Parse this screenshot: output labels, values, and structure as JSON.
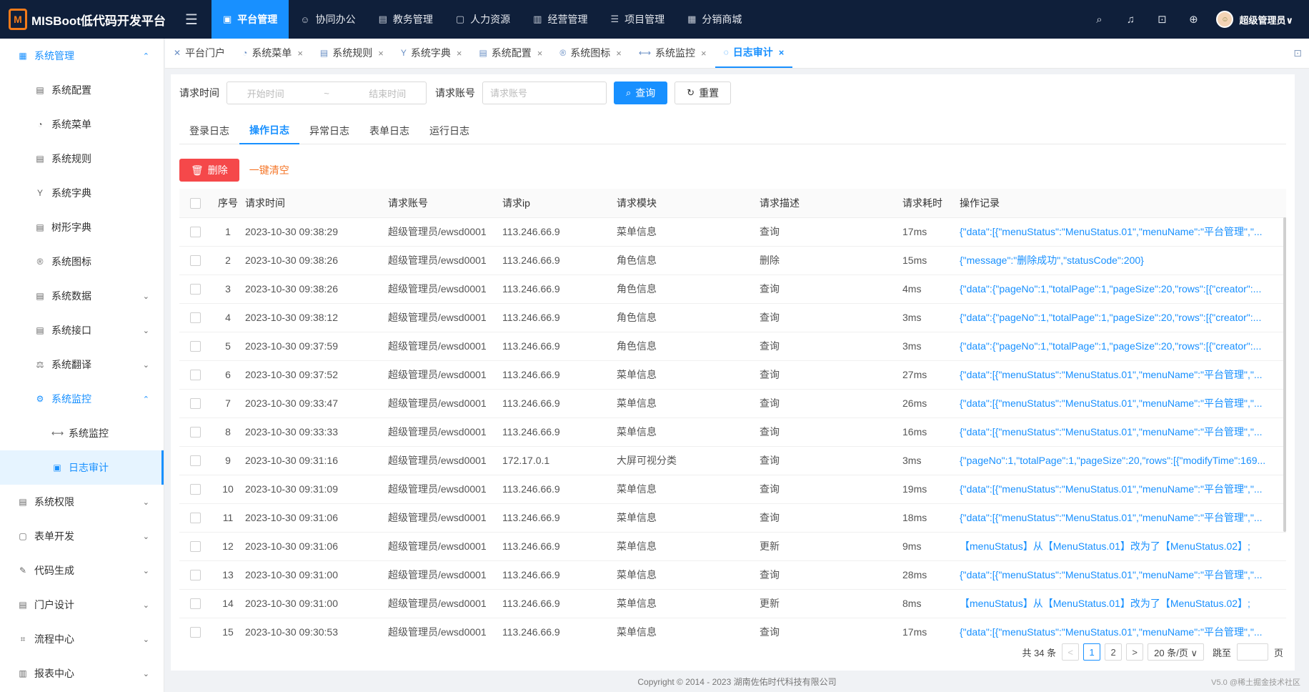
{
  "topbar": {
    "logo_mark": "M",
    "app_title": "MISBoot低代码开发平台",
    "nav": [
      {
        "label": "平台管理",
        "icon": "▣",
        "active": true
      },
      {
        "label": "协同办公",
        "icon": "☺",
        "active": false
      },
      {
        "label": "教务管理",
        "icon": "▤",
        "active": false
      },
      {
        "label": "人力资源",
        "icon": "▢",
        "active": false
      },
      {
        "label": "经营管理",
        "icon": "▥",
        "active": false
      },
      {
        "label": "项目管理",
        "icon": "☰",
        "active": false
      },
      {
        "label": "分销商城",
        "icon": "▦",
        "active": false
      }
    ],
    "user_name": "超级管理员∨"
  },
  "sidebar": {
    "items": [
      {
        "label": "系统管理",
        "icon": "▦",
        "level": 1,
        "arrow": "⌃",
        "state": "open"
      },
      {
        "label": "系统配置",
        "icon": "▤",
        "level": 2,
        "arrow": "",
        "state": ""
      },
      {
        "label": "系统菜单",
        "icon": "◔",
        "level": 2,
        "arrow": "",
        "state": ""
      },
      {
        "label": "系统规则",
        "icon": "▤",
        "level": 2,
        "arrow": "",
        "state": ""
      },
      {
        "label": "系统字典",
        "icon": "Y",
        "level": 2,
        "arrow": "",
        "state": ""
      },
      {
        "label": "树形字典",
        "icon": "▤",
        "level": 2,
        "arrow": "",
        "state": ""
      },
      {
        "label": "系统图标",
        "icon": "®",
        "level": 2,
        "arrow": "",
        "state": ""
      },
      {
        "label": "系统数据",
        "icon": "▤",
        "level": 2,
        "arrow": "⌄",
        "state": ""
      },
      {
        "label": "系统接口",
        "icon": "▤",
        "level": 2,
        "arrow": "⌄",
        "state": ""
      },
      {
        "label": "系统翻译",
        "icon": "⚖",
        "level": 2,
        "arrow": "⌄",
        "state": ""
      },
      {
        "label": "系统监控",
        "icon": "⚙",
        "level": 2,
        "arrow": "⌃",
        "state": "open"
      },
      {
        "label": "系统监控",
        "icon": "⟷",
        "level": 3,
        "arrow": "",
        "state": ""
      },
      {
        "label": "日志审计",
        "icon": "▣",
        "level": 3,
        "arrow": "",
        "state": "selected"
      },
      {
        "label": "系统权限",
        "icon": "▤",
        "level": 1,
        "arrow": "⌄",
        "state": ""
      },
      {
        "label": "表单开发",
        "icon": "▢",
        "level": 1,
        "arrow": "⌄",
        "state": ""
      },
      {
        "label": "代码生成",
        "icon": "✎",
        "level": 1,
        "arrow": "⌄",
        "state": ""
      },
      {
        "label": "门户设计",
        "icon": "▤",
        "level": 1,
        "arrow": "⌄",
        "state": ""
      },
      {
        "label": "流程中心",
        "icon": "⌗",
        "level": 1,
        "arrow": "⌄",
        "state": ""
      },
      {
        "label": "报表中心",
        "icon": "▥",
        "level": 1,
        "arrow": "⌄",
        "state": ""
      }
    ]
  },
  "tabs": [
    {
      "label": "平台门户",
      "icon": "✕",
      "closable": false,
      "active": false
    },
    {
      "label": "系统菜单",
      "icon": "◔",
      "closable": true,
      "active": false
    },
    {
      "label": "系统规则",
      "icon": "▤",
      "closable": true,
      "active": false
    },
    {
      "label": "系统字典",
      "icon": "Y",
      "closable": true,
      "active": false
    },
    {
      "label": "系统配置",
      "icon": "▤",
      "closable": true,
      "active": false
    },
    {
      "label": "系统图标",
      "icon": "®",
      "closable": true,
      "active": false
    },
    {
      "label": "系统监控",
      "icon": "⟷",
      "closable": true,
      "active": false
    },
    {
      "label": "日志审计",
      "icon": "◌",
      "closable": true,
      "active": true
    }
  ],
  "filter": {
    "time_label": "请求时间",
    "start_placeholder": "开始时间",
    "range_sep": "~",
    "end_placeholder": "结束时间",
    "account_label": "请求账号",
    "account_placeholder": "请求账号",
    "search_label": "查询",
    "reset_label": "重置"
  },
  "sub_tabs": [
    {
      "label": "登录日志",
      "active": false
    },
    {
      "label": "操作日志",
      "active": true
    },
    {
      "label": "异常日志",
      "active": false
    },
    {
      "label": "表单日志",
      "active": false
    },
    {
      "label": "运行日志",
      "active": false
    }
  ],
  "actions": {
    "delete_label": "删除",
    "clear_label": "一键清空"
  },
  "table": {
    "columns": [
      "",
      "序号",
      "请求时间",
      "请求账号",
      "请求ip",
      "请求模块",
      "请求描述",
      "请求耗时",
      "操作记录"
    ],
    "rows": [
      [
        "1",
        "2023-10-30 09:38:29",
        "超级管理员/ewsd0001",
        "113.246.66.9",
        "菜单信息",
        "查询",
        "17ms",
        "{\"data\":[{\"menuStatus\":\"MenuStatus.01\",\"menuName\":\"平台管理\",\"..."
      ],
      [
        "2",
        "2023-10-30 09:38:26",
        "超级管理员/ewsd0001",
        "113.246.66.9",
        "角色信息",
        "删除",
        "15ms",
        "{\"message\":\"删除成功\",\"statusCode\":200}"
      ],
      [
        "3",
        "2023-10-30 09:38:26",
        "超级管理员/ewsd0001",
        "113.246.66.9",
        "角色信息",
        "查询",
        "4ms",
        "{\"data\":{\"pageNo\":1,\"totalPage\":1,\"pageSize\":20,\"rows\":[{\"creator\":..."
      ],
      [
        "4",
        "2023-10-30 09:38:12",
        "超级管理员/ewsd0001",
        "113.246.66.9",
        "角色信息",
        "查询",
        "3ms",
        "{\"data\":{\"pageNo\":1,\"totalPage\":1,\"pageSize\":20,\"rows\":[{\"creator\":..."
      ],
      [
        "5",
        "2023-10-30 09:37:59",
        "超级管理员/ewsd0001",
        "113.246.66.9",
        "角色信息",
        "查询",
        "3ms",
        "{\"data\":{\"pageNo\":1,\"totalPage\":1,\"pageSize\":20,\"rows\":[{\"creator\":..."
      ],
      [
        "6",
        "2023-10-30 09:37:52",
        "超级管理员/ewsd0001",
        "113.246.66.9",
        "菜单信息",
        "查询",
        "27ms",
        "{\"data\":[{\"menuStatus\":\"MenuStatus.01\",\"menuName\":\"平台管理\",\"..."
      ],
      [
        "7",
        "2023-10-30 09:33:47",
        "超级管理员/ewsd0001",
        "113.246.66.9",
        "菜单信息",
        "查询",
        "26ms",
        "{\"data\":[{\"menuStatus\":\"MenuStatus.01\",\"menuName\":\"平台管理\",\"..."
      ],
      [
        "8",
        "2023-10-30 09:33:33",
        "超级管理员/ewsd0001",
        "113.246.66.9",
        "菜单信息",
        "查询",
        "16ms",
        "{\"data\":[{\"menuStatus\":\"MenuStatus.01\",\"menuName\":\"平台管理\",\"..."
      ],
      [
        "9",
        "2023-10-30 09:31:16",
        "超级管理员/ewsd0001",
        "172.17.0.1",
        "大屏可视分类",
        "查询",
        "3ms",
        "{\"pageNo\":1,\"totalPage\":1,\"pageSize\":20,\"rows\":[{\"modifyTime\":169..."
      ],
      [
        "10",
        "2023-10-30 09:31:09",
        "超级管理员/ewsd0001",
        "113.246.66.9",
        "菜单信息",
        "查询",
        "19ms",
        "{\"data\":[{\"menuStatus\":\"MenuStatus.01\",\"menuName\":\"平台管理\",\"..."
      ],
      [
        "11",
        "2023-10-30 09:31:06",
        "超级管理员/ewsd0001",
        "113.246.66.9",
        "菜单信息",
        "查询",
        "18ms",
        "{\"data\":[{\"menuStatus\":\"MenuStatus.01\",\"menuName\":\"平台管理\",\"..."
      ],
      [
        "12",
        "2023-10-30 09:31:06",
        "超级管理员/ewsd0001",
        "113.246.66.9",
        "菜单信息",
        "更新",
        "9ms",
        "【menuStatus】从【MenuStatus.01】改为了【MenuStatus.02】;"
      ],
      [
        "13",
        "2023-10-30 09:31:00",
        "超级管理员/ewsd0001",
        "113.246.66.9",
        "菜单信息",
        "查询",
        "28ms",
        "{\"data\":[{\"menuStatus\":\"MenuStatus.01\",\"menuName\":\"平台管理\",\"..."
      ],
      [
        "14",
        "2023-10-30 09:31:00",
        "超级管理员/ewsd0001",
        "113.246.66.9",
        "菜单信息",
        "更新",
        "8ms",
        "【menuStatus】从【MenuStatus.01】改为了【MenuStatus.02】;"
      ],
      [
        "15",
        "2023-10-30 09:30:53",
        "超级管理员/ewsd0001",
        "113.246.66.9",
        "菜单信息",
        "查询",
        "17ms",
        "{\"data\":[{\"menuStatus\":\"MenuStatus.01\",\"menuName\":\"平台管理\",\"..."
      ]
    ]
  },
  "pagination": {
    "total": "共 34 条",
    "prev": "<",
    "pages": [
      "1",
      "2"
    ],
    "current": "1",
    "next": ">",
    "page_size": "20 条/页 ∨",
    "jump_label": "跳至",
    "page_suffix": "页"
  },
  "footer": {
    "copyright": "Copyright © 2014 - 2023 湖南佐佑时代科技有限公司",
    "right_text": "V5.0 @稀土掘金技术社区"
  },
  "colors": {
    "primary": "#1890ff",
    "topbar": "#0f1f3a",
    "danger": "#f5484a",
    "orange": "#f5772a"
  }
}
